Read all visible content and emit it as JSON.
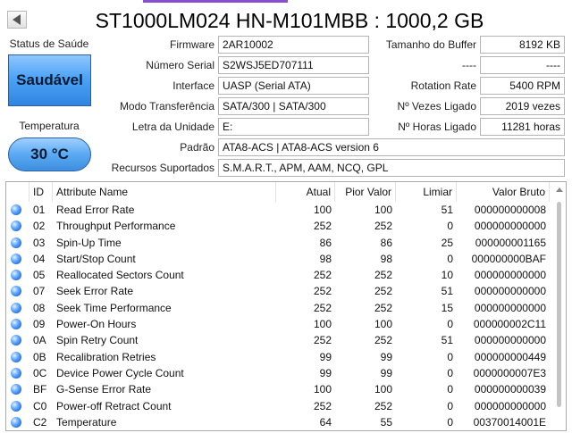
{
  "header": {
    "title": "ST1000LM024 HN-M101MBB : 1000,2 GB"
  },
  "health": {
    "label": "Status de Saúde",
    "value": "Saudável",
    "color": "#4da3f5"
  },
  "temperature": {
    "label": "Temperatura",
    "value": "30 °C"
  },
  "info": {
    "firmware": {
      "label": "Firmware",
      "value": "2AR10002"
    },
    "serial": {
      "label": "Número Serial",
      "value": "S2WSJ5ED707111"
    },
    "interface": {
      "label": "Interface",
      "value": "UASP (Serial ATA)"
    },
    "transfer": {
      "label": "Modo Transferência",
      "value": "SATA/300 | SATA/300"
    },
    "drive_letter": {
      "label": "Letra da Unidade",
      "value": "E:"
    },
    "standard": {
      "label": "Padrão",
      "value": "ATA8-ACS | ATA8-ACS version 6"
    },
    "features": {
      "label": "Recursos Suportados",
      "value": "S.M.A.R.T., APM, AAM, NCQ, GPL"
    },
    "buffer": {
      "label": "Tamanho do Buffer",
      "value": "8192 KB"
    },
    "blank_label": "----",
    "blank_value": "----",
    "rotation": {
      "label": "Rotation Rate",
      "value": "5400 RPM"
    },
    "power_count": {
      "label": "Nº Vezes Ligado",
      "value": "2019 vezes"
    },
    "power_hours": {
      "label": "Nº Horas Ligado",
      "value": "11281 horas"
    }
  },
  "table": {
    "columns": [
      "ID",
      "Attribute Name",
      "Atual",
      "Pior Valor",
      "Limiar",
      "Valor Bruto"
    ],
    "rows": [
      [
        "01",
        "Read Error Rate",
        "100",
        "100",
        "51",
        "000000000008"
      ],
      [
        "02",
        "Throughput Performance",
        "252",
        "252",
        "0",
        "000000000000"
      ],
      [
        "03",
        "Spin-Up Time",
        "86",
        "86",
        "25",
        "000000001165"
      ],
      [
        "04",
        "Start/Stop Count",
        "98",
        "98",
        "0",
        "000000000BAF"
      ],
      [
        "05",
        "Reallocated Sectors Count",
        "252",
        "252",
        "10",
        "000000000000"
      ],
      [
        "07",
        "Seek Error Rate",
        "252",
        "252",
        "51",
        "000000000000"
      ],
      [
        "08",
        "Seek Time Performance",
        "252",
        "252",
        "15",
        "000000000000"
      ],
      [
        "09",
        "Power-On Hours",
        "100",
        "100",
        "0",
        "000000002C11"
      ],
      [
        "0A",
        "Spin Retry Count",
        "252",
        "252",
        "51",
        "000000000000"
      ],
      [
        "0B",
        "Recalibration Retries",
        "99",
        "99",
        "0",
        "000000000449"
      ],
      [
        "0C",
        "Device Power Cycle Count",
        "99",
        "99",
        "0",
        "0000000007E3"
      ],
      [
        "BF",
        "G-Sense Error Rate",
        "100",
        "100",
        "0",
        "000000000039"
      ],
      [
        "C0",
        "Power-off Retract Count",
        "252",
        "252",
        "0",
        "000000000000"
      ],
      [
        "C2",
        "Temperature",
        "64",
        "55",
        "0",
        "00370014001E"
      ]
    ]
  }
}
